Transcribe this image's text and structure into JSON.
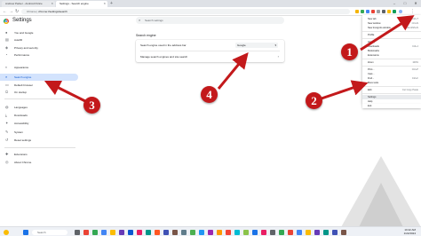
{
  "window": {
    "tabs": [
      {
        "label": "Andrew Parker - Android Police"
      },
      {
        "label": "Settings - Search engine"
      }
    ],
    "new_tab": "+",
    "controls": [
      "–",
      "□",
      "✕"
    ]
  },
  "address_bar": {
    "site_label": "Chrome",
    "url": "chrome://settings/search",
    "back": "←",
    "forward": "→",
    "reload": "↻"
  },
  "header": {
    "title": "Settings",
    "search_placeholder": "Search settings"
  },
  "sidebar": {
    "items": [
      {
        "label": "You and Google",
        "icon": "person-icon",
        "glyph": "👤"
      },
      {
        "label": "Autofill",
        "icon": "autofill-icon",
        "glyph": "📋"
      },
      {
        "label": "Privacy and security",
        "icon": "shield-icon",
        "glyph": "🛡"
      },
      {
        "label": "Performance",
        "icon": "speed-icon",
        "glyph": "⚡"
      },
      {
        "label": "Appearance",
        "icon": "palette-icon",
        "glyph": "🎨"
      },
      {
        "label": "Search engine",
        "icon": "search-icon",
        "glyph": "🔍"
      },
      {
        "label": "Default browser",
        "icon": "browser-icon",
        "glyph": "▭"
      },
      {
        "label": "On startup",
        "icon": "power-icon",
        "glyph": "⏻"
      },
      {
        "label": "Languages",
        "icon": "globe-icon",
        "glyph": "🌐"
      },
      {
        "label": "Downloads",
        "icon": "download-icon",
        "glyph": "⤓"
      },
      {
        "label": "Accessibility",
        "icon": "accessibility-icon",
        "glyph": "♿"
      },
      {
        "label": "System",
        "icon": "wrench-icon",
        "glyph": "🔧"
      },
      {
        "label": "Reset settings",
        "icon": "reset-icon",
        "glyph": "↺"
      },
      {
        "label": "Extensions",
        "icon": "puzzle-icon",
        "glyph": "🧩"
      },
      {
        "label": "About Chrome",
        "icon": "chrome-icon",
        "glyph": "◎"
      }
    ],
    "active_index": 5
  },
  "main": {
    "section_title": "Search engine",
    "row1_label": "Search engine used in the address bar",
    "row1_value": "Google",
    "row2_label": "Manage search engines and site search"
  },
  "menu": {
    "items": [
      {
        "label": "New tab",
        "kb": "Ctrl+T"
      },
      {
        "label": "New window",
        "kb": "Ctrl+N"
      },
      {
        "label": "New Incognito window",
        "kb": "Ctrl+Shift+N"
      },
      {
        "label": "Profile",
        "kb": ""
      },
      {
        "label": "History",
        "kb": ""
      },
      {
        "label": "Downloads",
        "kb": "Ctrl+J"
      },
      {
        "label": "Bookmarks",
        "kb": ""
      },
      {
        "label": "Extensions",
        "kb": ""
      },
      {
        "label": "Zoom",
        "kb": "100%"
      },
      {
        "label": "Print...",
        "kb": "Ctrl+P"
      },
      {
        "label": "Cast...",
        "kb": ""
      },
      {
        "label": "Find...",
        "kb": "Ctrl+F"
      },
      {
        "label": "More tools",
        "kb": ""
      },
      {
        "label": "Edit",
        "kb": "Cut  Copy  Paste"
      },
      {
        "label": "Settings",
        "kb": ""
      },
      {
        "label": "Help",
        "kb": ""
      },
      {
        "label": "Exit",
        "kb": ""
      }
    ]
  },
  "annotations": [
    "1",
    "2",
    "3",
    "4"
  ],
  "annotation_color": "#c3191b",
  "taskbar": {
    "search_placeholder": "Search",
    "time": "10:42 AM",
    "date": "1/22/2024"
  }
}
